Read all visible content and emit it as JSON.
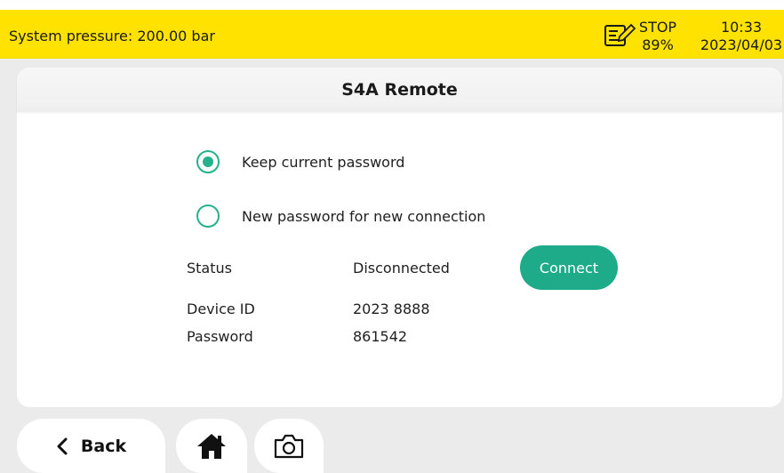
{
  "status_bar": {
    "pressure_text": "System pressure: 200.00 bar",
    "mode_icon": "clipboard-edit-icon",
    "mode_state": "STOP",
    "mode_percent": "89%",
    "time": "10:33",
    "date": "2023/04/03",
    "background_color": "#ffe200"
  },
  "page": {
    "title": "S4A Remote"
  },
  "options": [
    {
      "label": "Keep current password",
      "checked": true
    },
    {
      "label": "New password for new connection",
      "checked": false
    }
  ],
  "info": {
    "status_label": "Status",
    "status_value": "Disconnected",
    "device_id_label": "Device ID",
    "device_id_value": "2023 8888",
    "password_label": "Password",
    "password_value": "861542"
  },
  "connect_button": {
    "label": "Connect",
    "color": "#1eab89"
  },
  "bottom_nav": {
    "back_label": "Back",
    "back_icon": "chevron-left-icon",
    "home_icon": "home-icon",
    "camera_icon": "camera-icon"
  },
  "accent_color": "#23b28c"
}
